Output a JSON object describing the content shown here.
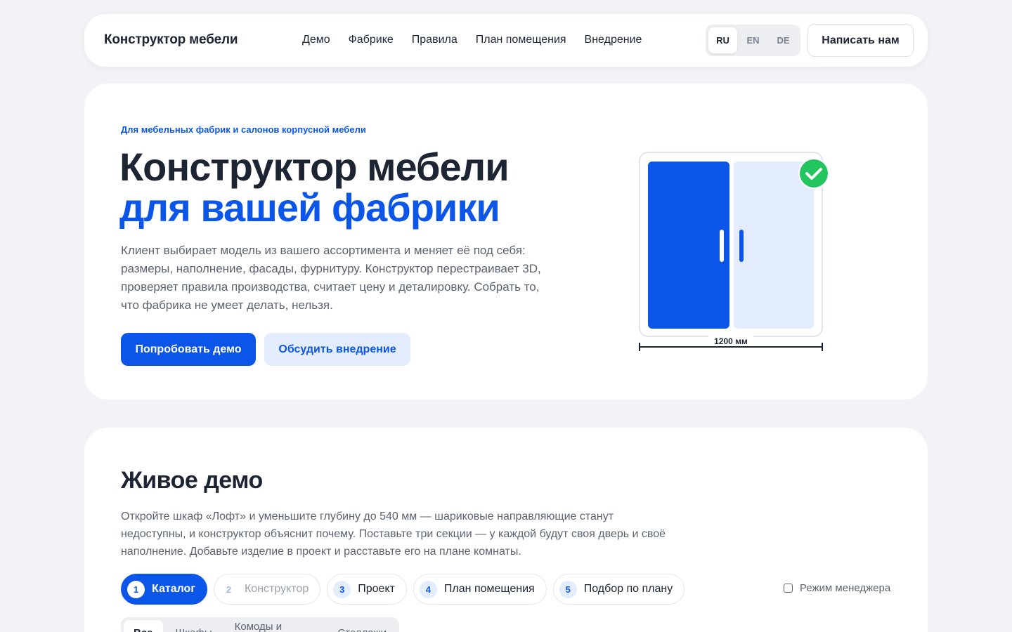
{
  "header": {
    "logo": "Конструктор мебели",
    "nav": [
      "Демо",
      "Фабрике",
      "Правила",
      "План помещения",
      "Внедрение"
    ],
    "languages": [
      "RU",
      "EN",
      "DE"
    ],
    "active_language": "RU",
    "contact_label": "Написать нам"
  },
  "hero": {
    "eyebrow": "Для мебельных фабрик и салонов корпусной мебели",
    "title_line1": "Конструктор мебели",
    "title_line2": "для вашей фабрики",
    "text": "Клиент выбирает модель из вашего ассортимента и меняет её под себя: размеры, наполнение, фасады, фурнитуру. Конструктор перестраивает 3D, проверяет правила производства, считает цену и деталировку. Собрать то, что фабрика не умеет делать, нельзя.",
    "primary_label": "Попробовать демо",
    "secondary_label": "Обсудить внедрение",
    "illustration": {
      "width_label": "1200 мм",
      "check_icon": "check-circle-icon"
    }
  },
  "demo": {
    "title": "Живое демо",
    "text": "Откройте шкаф «Лофт» и уменьшите глубину до 540 мм — шариковые направляющие станут недоступны, и конструктор объяснит почему. Поставьте три секции — у каждой будут своя дверь и своё наполнение. Добавьте изделие в проект и расставьте его на плане комнаты.",
    "steps": [
      {
        "num": "1",
        "label": "Каталог",
        "state": "active"
      },
      {
        "num": "2",
        "label": "Конструктор",
        "state": "disabled"
      },
      {
        "num": "3",
        "label": "Проект",
        "state": "normal"
      },
      {
        "num": "4",
        "label": "План помещения",
        "state": "normal"
      },
      {
        "num": "5",
        "label": "Подбор по плану",
        "state": "normal"
      }
    ],
    "manager_mode_label": "Режим менеджера",
    "manager_mode_checked": false,
    "filters": [
      "Все",
      "Шкафы",
      "Комоды и тумбы",
      "Стеллажи"
    ],
    "active_filter": "Все"
  },
  "colors": {
    "accent": "#0b56e8",
    "accent_light": "#e4edfd",
    "success": "#22c55e",
    "background": "#f1f3f6"
  }
}
